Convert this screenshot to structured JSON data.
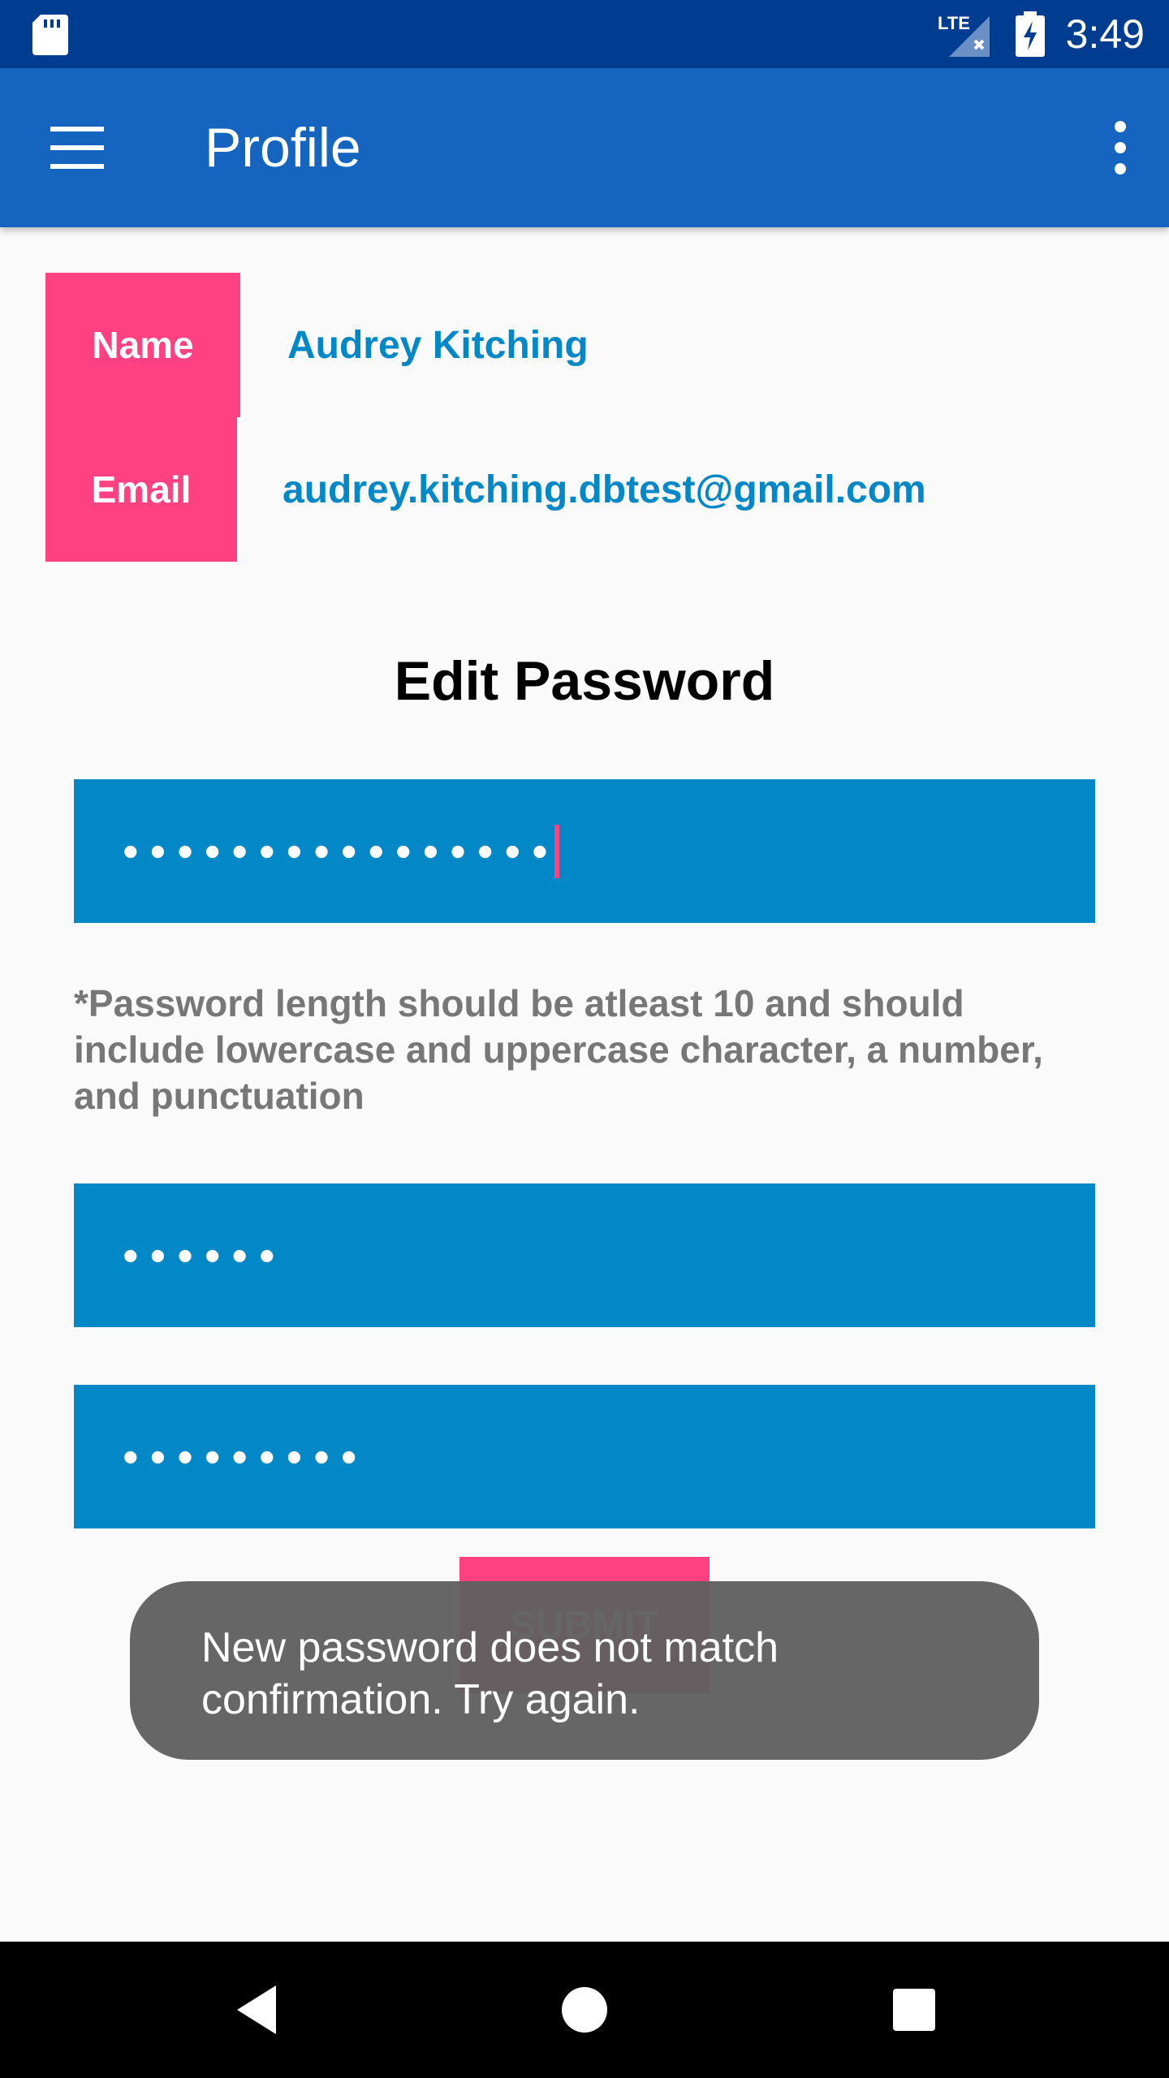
{
  "status_bar": {
    "time": "3:49",
    "network": "LTE",
    "icons": [
      "sd-card-icon",
      "signal-icon",
      "battery-charging-icon"
    ]
  },
  "app_bar": {
    "title": "Profile",
    "menu_icon": "hamburger-menu-icon",
    "overflow_icon": "more-vert-icon"
  },
  "profile": {
    "name_label": "Name",
    "name_value": "Audrey Kitching",
    "email_label": "Email",
    "email_value": "audrey.kitching.dbtest@gmail.com"
  },
  "edit_password": {
    "title": "Edit Password",
    "current_password_mask": "••••••••••••••••",
    "hint": "*Password length should be atleast 10 and should include lowercase and uppercase character, a number, and punctuation",
    "new_password_mask": "••••••",
    "confirm_password_mask": "•••••••••",
    "submit_label": "SUBMIT"
  },
  "toast": {
    "message": "New password does not match confirmation. Try again."
  },
  "colors": {
    "status_bar": "#003c8f",
    "app_bar": "#1565c0",
    "accent": "#ff4081",
    "field": "#0288c7",
    "link_text": "#0288c7"
  }
}
